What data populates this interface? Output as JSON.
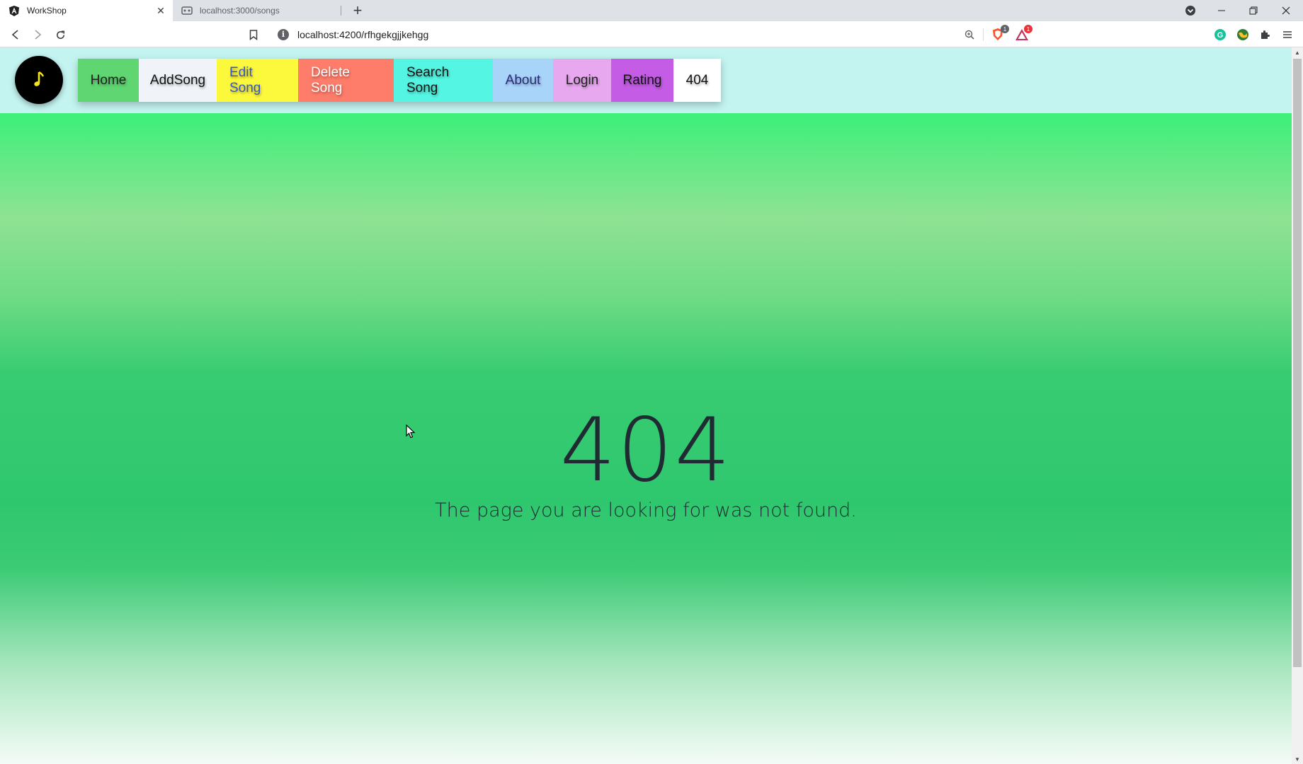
{
  "browser": {
    "tabs": [
      {
        "title": "WorkShop",
        "active": true
      },
      {
        "title": "localhost:3000/songs",
        "active": false
      }
    ],
    "new_tab_label": "+",
    "url": "localhost:4200/rfhgekgjjkehgg",
    "badges": {
      "brave_count": "1",
      "rewards_count": "1"
    }
  },
  "navbar": {
    "logo_glyph": "♪",
    "items": [
      {
        "label": "Home",
        "bg": "#5fd672",
        "color": "#222222"
      },
      {
        "label": "AddSong",
        "bg": "#f0f4f8",
        "color": "#111111"
      },
      {
        "label": "Edit Song",
        "bg": "#fcf93c",
        "color": "#3a55c8"
      },
      {
        "label": "Delete Song",
        "bg": "#fd7c6a",
        "color": "#ffffff"
      },
      {
        "label": "Search Song",
        "bg": "#55f5e3",
        "color": "#111111"
      },
      {
        "label": "About",
        "bg": "#a8d4fa",
        "color": "#2a2a7a"
      },
      {
        "label": "Login",
        "bg": "#e8a8f0",
        "color": "#222222"
      },
      {
        "label": "Rating",
        "bg": "#c45ce6",
        "color": "#111111"
      },
      {
        "label": "404",
        "bg": "#ffffff",
        "color": "#111111"
      }
    ]
  },
  "main": {
    "code": "404",
    "message": "The page you are looking for was not found."
  },
  "colors": {
    "navbar_bg": "#c4f4f0",
    "page_green": "#2fc76e",
    "text_dark": "#1f2a33"
  },
  "icons": {
    "tab_favicon": "angular-icon",
    "inactive_tab_favicon": "page-icon",
    "back": "back-arrow-icon",
    "forward": "forward-arrow-icon",
    "reload": "reload-icon",
    "bookmark": "bookmark-icon",
    "site_info": "info-icon",
    "zoom": "zoom-icon",
    "brave_shields": "brave-shield-icon",
    "brave_rewards": "rewards-triangle-icon",
    "grammarly": "grammarly-icon",
    "globe": "globe-extension-icon",
    "extensions": "puzzle-icon",
    "menu": "hamburger-menu-icon"
  }
}
